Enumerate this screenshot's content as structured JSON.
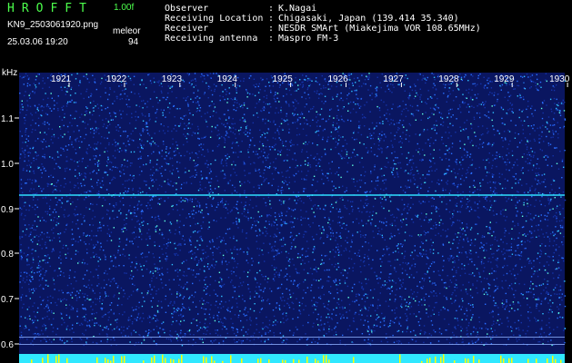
{
  "header": {
    "app_title": "HROFFT",
    "version": "1.00f",
    "filename": "KN9_2503061920.png",
    "mode": "meleor",
    "datetime": "25.03.06 19:20",
    "count": "94",
    "info": [
      {
        "label": "Observer",
        "sep": ":",
        "value": "K.Nagai"
      },
      {
        "label": "Receiving Location",
        "sep": ":",
        "value": "Chigasaki, Japan (139.414 35.340)"
      },
      {
        "label": "Receiver",
        "sep": ":",
        "value": "NESDR SMArt (Miakejima VOR 108.65MHz)"
      },
      {
        "label": "Receiving antenna",
        "sep": ":",
        "value": "Maspro FM-3"
      }
    ]
  },
  "spectrogram": {
    "y_unit": "kHz",
    "y_ticks": [
      "1.1",
      "1.0",
      "0.9",
      "0.8",
      "0.7",
      "0.6"
    ],
    "x_ticks": [
      "1921",
      "1922",
      "1923",
      "1924",
      "1925",
      "1926",
      "1927",
      "1928",
      "1929",
      "1930"
    ],
    "colors": {
      "background": "#000000",
      "noise_low": "#0a1a7a",
      "noise_high": "#2a6fff",
      "signal": "#30e0ff",
      "baseline": "#30e8ff",
      "peak": "#ffff00"
    }
  }
}
